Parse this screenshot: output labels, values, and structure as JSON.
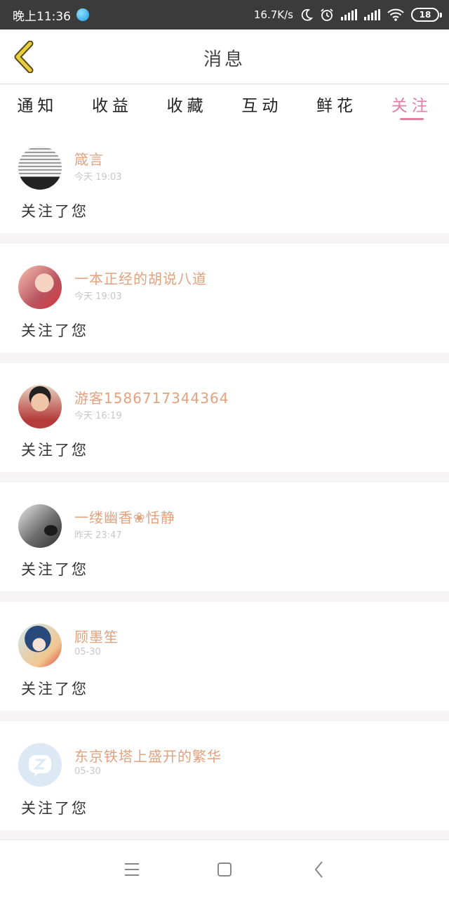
{
  "status_bar": {
    "time": "晚上11:36",
    "network_speed": "16.7K/s",
    "battery_level": "18",
    "icons": [
      "app-notification-icon",
      "moon-icon",
      "alarm-icon",
      "signal-icon",
      "signal-icon",
      "wifi-icon",
      "battery-icon"
    ]
  },
  "header": {
    "title": "消息",
    "back_icon": "chevron-left-icon",
    "back_color": "#e8cf3f"
  },
  "tabs": [
    {
      "label": "通知",
      "active": false
    },
    {
      "label": "收益",
      "active": false
    },
    {
      "label": "收藏",
      "active": false
    },
    {
      "label": "互动",
      "active": false
    },
    {
      "label": "鲜花",
      "active": false
    },
    {
      "label": "关注",
      "active": true
    }
  ],
  "colors": {
    "accent": "#e17fa5",
    "username": "#e1a27f",
    "timestamp": "#c7c7c7"
  },
  "messages": [
    {
      "name": "箴言",
      "time": "今天 19:03",
      "text": "关注了您"
    },
    {
      "name": "一本正经的胡说八道",
      "time": "今天 19:03",
      "text": "关注了您"
    },
    {
      "name": "游客15867173443​64",
      "time": "今天 16:19",
      "text": "关注了您"
    },
    {
      "name": "一缕幽香❀恬静",
      "time": "昨天 23:47",
      "text": "关注了您"
    },
    {
      "name": "顾墨笙",
      "time": "05-30",
      "text": "关注了您"
    },
    {
      "name": "东京铁塔上盛开的繁华",
      "time": "05-30",
      "text": "关注了您"
    }
  ],
  "navbar": {
    "icons": [
      "menu-icon",
      "home-square-icon",
      "back-arrow-icon"
    ]
  }
}
